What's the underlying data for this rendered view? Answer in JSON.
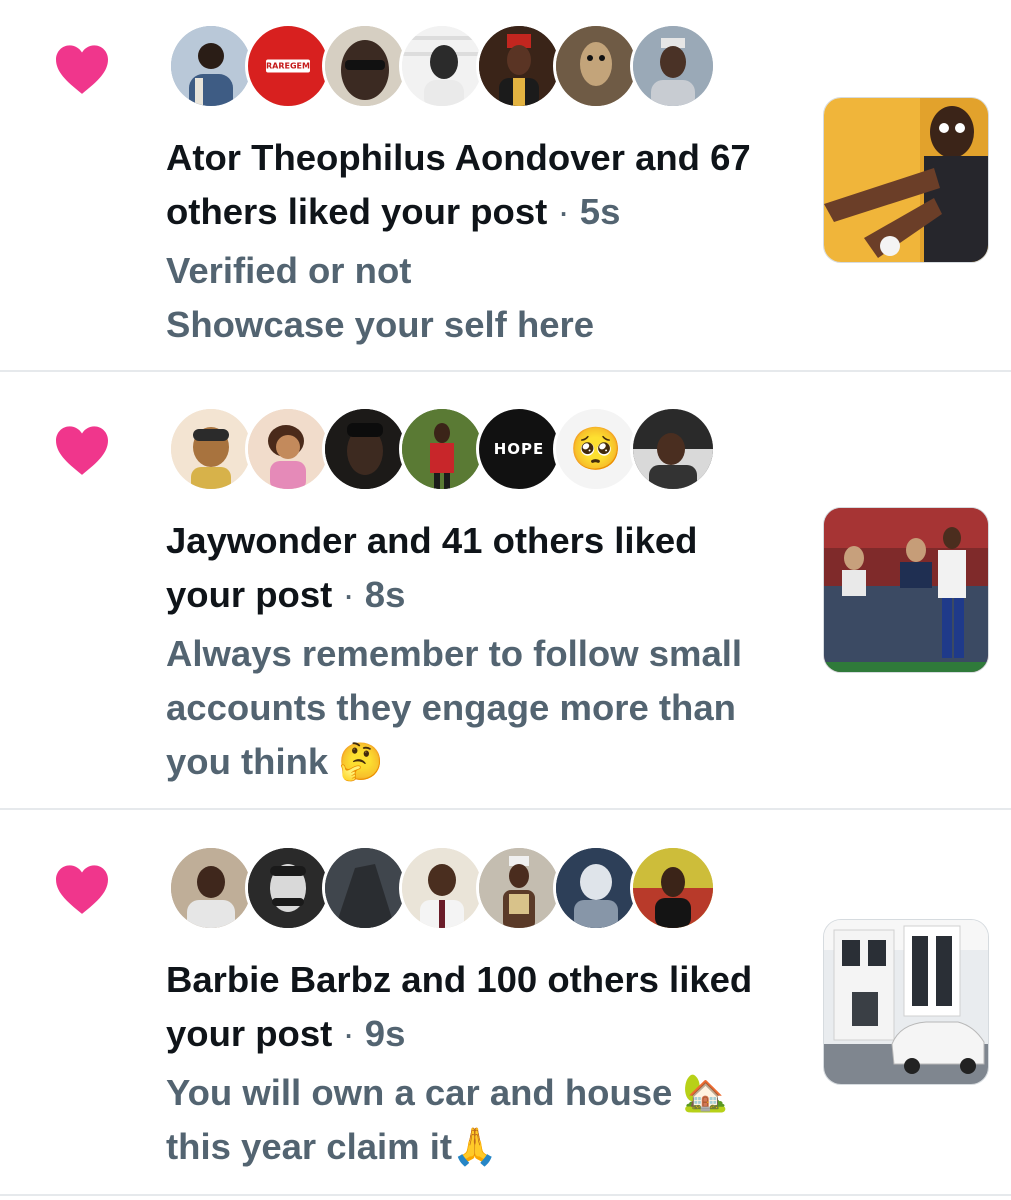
{
  "notifications": [
    {
      "headline": "Ator Theophilus Aondover and 67 others liked your post",
      "separator": "·",
      "time": "5s",
      "post_text": "Verified or not\nShowcase your self here",
      "avatar_labels": [
        "",
        "RAREGEM",
        "",
        "",
        "",
        "",
        ""
      ],
      "thumbnail": "photo-man-reaching-out-orange-background"
    },
    {
      "headline": "Jaywonder and 41 others liked your post",
      "separator": "·",
      "time": "8s",
      "post_text": "Always remember to follow small accounts they engage more than you think 🤔",
      "avatar_labels": [
        "",
        "",
        "",
        "",
        "HOPE",
        "🥺",
        ""
      ],
      "thumbnail": "photo-football-players-stadium"
    },
    {
      "headline": "Barbie Barbz and 100 others liked your post",
      "separator": "·",
      "time": "9s",
      "post_text": "You will own a car and house 🏡 this year claim it🙏",
      "avatar_labels": [
        "",
        "",
        "",
        "",
        "",
        "",
        ""
      ],
      "thumbnail": "photo-white-house-with-car"
    }
  ],
  "colors": {
    "like_heart": "#f0368c",
    "separator_line": "#e6e9ec",
    "primary_text": "#0f1419",
    "secondary_text": "#536471"
  },
  "icons": [
    "heart-icon"
  ]
}
